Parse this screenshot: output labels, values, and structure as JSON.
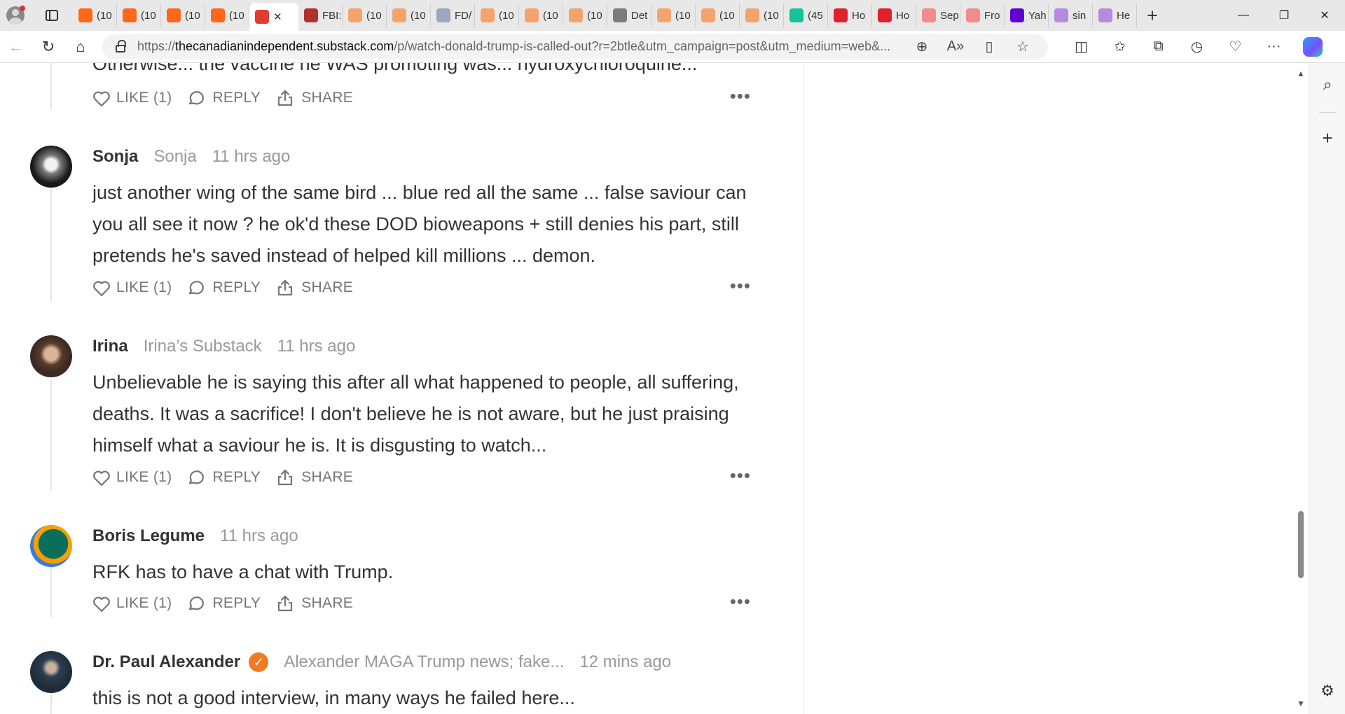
{
  "browser": {
    "tabs": [
      {
        "title": "(10",
        "favicon": "substack",
        "color": "#ff6719"
      },
      {
        "title": "(10",
        "favicon": "substack",
        "color": "#ff6719"
      },
      {
        "title": "(10",
        "favicon": "substack",
        "color": "#ff6719"
      },
      {
        "title": "(10",
        "favicon": "substack",
        "color": "#ff6719"
      },
      {
        "title": "",
        "favicon": "substack-active",
        "color": "#e03c31",
        "active": true
      },
      {
        "title": "FBI:",
        "favicon": "news",
        "color": "#b03030"
      },
      {
        "title": "(10",
        "favicon": "substack",
        "color": "#f4a36c"
      },
      {
        "title": "(10",
        "favicon": "substack",
        "color": "#f4a36c"
      },
      {
        "title": "FD/",
        "favicon": "video",
        "color": "#9aa7c0"
      },
      {
        "title": "(10",
        "favicon": "substack",
        "color": "#f4a36c"
      },
      {
        "title": "(10",
        "favicon": "substack",
        "color": "#f4a36c"
      },
      {
        "title": "(10",
        "favicon": "substack",
        "color": "#f4a36c"
      },
      {
        "title": "Det",
        "favicon": "arrow",
        "color": "#7b7b7b"
      },
      {
        "title": "(10",
        "favicon": "substack",
        "color": "#f4a36c"
      },
      {
        "title": "(10",
        "favicon": "substack",
        "color": "#f4a36c"
      },
      {
        "title": "(10",
        "favicon": "substack",
        "color": "#f4a36c"
      },
      {
        "title": "(45",
        "favicon": "g",
        "color": "#15c39a"
      },
      {
        "title": "Ho",
        "favicon": "red",
        "color": "#e0202b"
      },
      {
        "title": "Ho",
        "favicon": "red",
        "color": "#e0202b"
      },
      {
        "title": "Sep",
        "favicon": "youtube",
        "color": "#f28b8b"
      },
      {
        "title": "Fro",
        "favicon": "youtube",
        "color": "#f28b8b"
      },
      {
        "title": "Yah",
        "favicon": "yahoo",
        "color": "#6001d2"
      },
      {
        "title": "sin",
        "favicon": "yahoo",
        "color": "#b58be0"
      },
      {
        "title": "He",
        "favicon": "yahoo",
        "color": "#b58be0"
      }
    ],
    "address": {
      "scheme": "https://",
      "host": "thecanadianindependent.substack.com",
      "path": "/p/watch-donald-trump-is-called-out?r=2btle&utm_campaign=post&utm_medium=web&..."
    },
    "accent_color": "#ff6719"
  },
  "partial_top_text": "Otherwise... the vaccine he WAS promoting was... hydroxychloroquine...",
  "action_labels": {
    "like": "LIKE (1)",
    "reply": "REPLY",
    "share": "SHARE",
    "more": "•••"
  },
  "comments": [
    {
      "name": "Sonja",
      "publication": "Sonja",
      "time": "11 hrs ago",
      "body": "just another wing of the same bird ... blue red all the same ... false saviour can you all see it now ? he ok'd these DOD bioweapons + still denies his part, still pretends he's saved instead of helped kill millions ... demon."
    },
    {
      "name": "Irina",
      "publication": "Irina’s Substack",
      "time": "11 hrs ago",
      "body": "Unbelievable he is saying this after all what happened to people, all suffering, deaths. It was a sacrifice! I don't believe he is not aware, but he just praising himself what a saviour he is. It is disgusting to watch..."
    },
    {
      "name": "Boris Legume",
      "publication": "",
      "time": "11 hrs ago",
      "body": "RFK has to have a chat with Trump."
    },
    {
      "name": "Dr. Paul Alexander",
      "verified": true,
      "publication": "Alexander MAGA Trump news; fake...",
      "time": "12 mins ago",
      "body": "this is not a good interview, in many ways he failed here..."
    }
  ]
}
